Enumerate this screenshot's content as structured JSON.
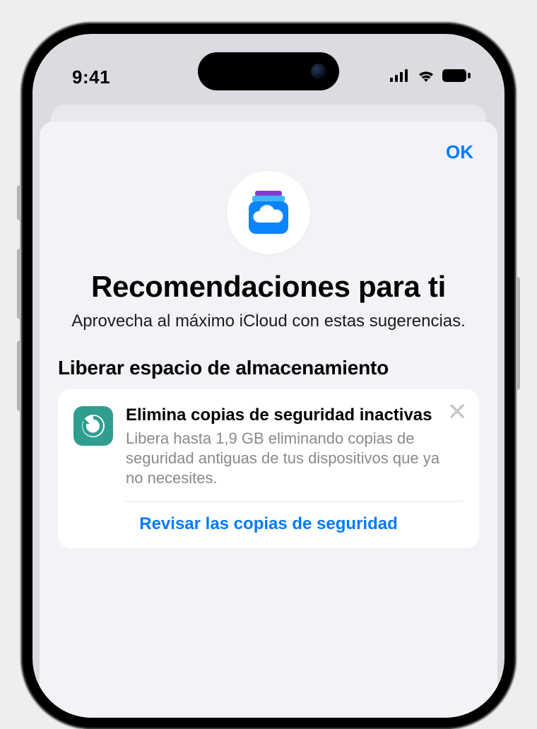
{
  "status": {
    "time": "9:41"
  },
  "sheet": {
    "done_label": "OK",
    "title": "Recomendaciones para ti",
    "subtitle": "Aprovecha al máximo iCloud con estas sugerencias.",
    "section_title": "Liberar espacio de almacenamiento",
    "card": {
      "title": "Elimina copias de seguridad inactivas",
      "description": "Libera hasta 1,9 GB eliminando copias de seguridad antiguas de tus dispositivos que ya no necesites.",
      "action_label": "Revisar las copias de seguridad"
    }
  }
}
